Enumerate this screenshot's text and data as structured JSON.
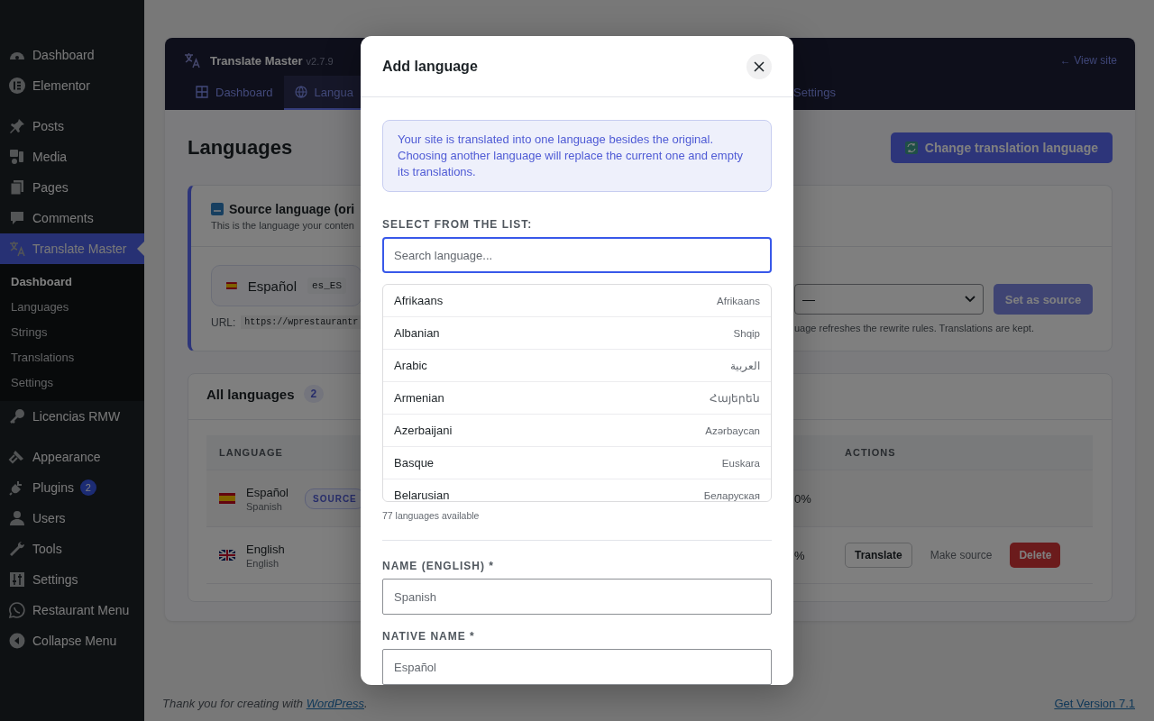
{
  "sidebar": {
    "groups": [
      [
        {
          "label": "Dashboard",
          "selected": false
        },
        {
          "label": "Elementor",
          "selected": false
        }
      ],
      [
        {
          "label": "Posts",
          "selected": false
        },
        {
          "label": "Media",
          "selected": false
        },
        {
          "label": "Pages",
          "selected": false
        },
        {
          "label": "Comments",
          "selected": false
        },
        {
          "label": "Translate Master",
          "selected": true,
          "children": [
            {
              "label": "Dashboard",
              "selected": true
            },
            {
              "label": "Languages",
              "selected": false
            },
            {
              "label": "Strings",
              "selected": false
            },
            {
              "label": "Translations",
              "selected": false
            },
            {
              "label": "Settings",
              "selected": false
            }
          ]
        },
        {
          "label": "Licencias RMW",
          "selected": false
        }
      ],
      [
        {
          "label": "Appearance",
          "selected": false
        },
        {
          "label": "Plugins",
          "selected": false,
          "badge": "2"
        },
        {
          "label": "Users",
          "selected": false
        },
        {
          "label": "Tools",
          "selected": false
        },
        {
          "label": "Settings",
          "selected": false
        },
        {
          "label": "Restaurant Menu",
          "selected": false
        },
        {
          "label": "Collapse Menu",
          "selected": false
        }
      ]
    ]
  },
  "plugin": {
    "header": {
      "brand": "Translate Master",
      "version": "v2.7.9",
      "view_site": "← View site",
      "tabs": [
        {
          "label": "Dashboard",
          "selected": false
        },
        {
          "label": "Langua",
          "selected": true
        },
        {
          "label": "Settings",
          "selected": false
        }
      ]
    },
    "title": "Languages",
    "change_button": "Change translation language",
    "source_card": {
      "title": "Source language (ori",
      "description": "This is the language your conten",
      "language": {
        "kind": "es",
        "name": "Español",
        "code": "es_ES"
      },
      "url_label": "URL:",
      "url": "https://wprestaurantr",
      "select_value": "—",
      "set_button": {
        "label": "Set as source",
        "disabled": true
      },
      "hint": "uage refreshes the rewrite rules. Translations are kept."
    },
    "languages_card": {
      "title": "All languages",
      "count": "2",
      "table": {
        "columns": [
          "LANGUAGE",
          "ACTIONS"
        ],
        "rows": [
          {
            "kind": "es",
            "name": "Español",
            "native": "Spanish",
            "badge": "SOURCE",
            "column_3": "0%",
            "actions": []
          },
          {
            "kind": "gb",
            "name": "English",
            "native": "English",
            "column_3": "%",
            "actions": [
              {
                "kind": "outline",
                "label": "Translate"
              },
              {
                "kind": "text",
                "label": "Make source"
              },
              {
                "kind": "danger",
                "label": "Delete"
              }
            ]
          }
        ]
      }
    }
  },
  "footer": {
    "text": "Thank you for creating with ",
    "link": "WordPress",
    "suffix": ".",
    "version_link": "Get Version 7.1"
  },
  "modal": {
    "title": "Add language",
    "notice": "Your site is translated into one language besides the original. Choosing another language will replace the current one and empty its translations.",
    "list_label": "SELECT FROM THE LIST:",
    "search": {
      "placeholder": "Search language...",
      "focused": true
    },
    "languages": [
      {
        "name": "Afrikaans",
        "native": "Afrikaans",
        "selected": false
      },
      {
        "name": "Albanian",
        "native": "Shqip",
        "selected": false
      },
      {
        "name": "Arabic",
        "native": "العربية",
        "selected": false
      },
      {
        "name": "Armenian",
        "native": "Հայերեն",
        "selected": false
      },
      {
        "name": "Azerbaijani",
        "native": "Azərbaycan",
        "selected": false
      },
      {
        "name": "Basque",
        "native": "Euskara",
        "selected": false
      },
      {
        "name": "Belarusian",
        "native": "Беларуская",
        "selected": false
      }
    ],
    "count": "77 languages available",
    "fields": [
      {
        "label": "NAME (ENGLISH) *",
        "placeholder": "Spanish"
      },
      {
        "label": "NATIVE NAME *",
        "placeholder": "Español"
      }
    ]
  }
}
